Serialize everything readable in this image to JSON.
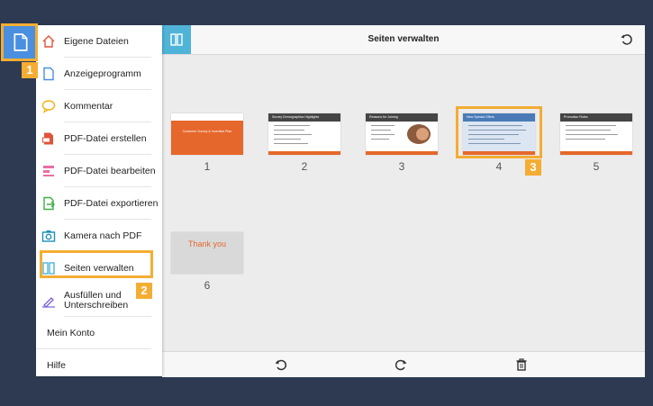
{
  "app": {
    "title": "Seiten verwalten"
  },
  "menu": {
    "items": [
      {
        "label": "Eigene Dateien",
        "icon": "home-icon"
      },
      {
        "label": "Anzeigeprogramm",
        "icon": "document-icon"
      },
      {
        "label": "Kommentar",
        "icon": "comment-icon"
      },
      {
        "label": "PDF-Datei erstellen",
        "icon": "pdf-create-icon"
      },
      {
        "label": "PDF-Datei bearbeiten",
        "icon": "pdf-edit-icon"
      },
      {
        "label": "PDF-Datei exportieren",
        "icon": "pdf-export-icon"
      },
      {
        "label": "Kamera nach PDF",
        "icon": "camera-icon"
      },
      {
        "label": "Seiten verwalten",
        "icon": "organize-pages-icon"
      },
      {
        "label": "Ausfüllen und Unterschreiben",
        "icon": "fill-sign-icon"
      },
      {
        "label": "Mein Konto"
      },
      {
        "label": "Hilfe"
      }
    ]
  },
  "pages": [
    {
      "num": "1",
      "title": "Customer Survey & Incentive Plan"
    },
    {
      "num": "2",
      "title": "Survey Demographics Highlights"
    },
    {
      "num": "3",
      "title": "Reasons for Joining"
    },
    {
      "num": "4",
      "title": "New Special Offers"
    },
    {
      "num": "5",
      "title": "Promotion Rules"
    },
    {
      "num": "6",
      "title": "Thank you"
    }
  ],
  "callouts": {
    "one": "1",
    "two": "2",
    "three": "3"
  },
  "colors": {
    "accent": "#f4ad33",
    "slide_orange": "#e6672b",
    "blue": "#4a8fe0",
    "background": "#2d3a52"
  }
}
